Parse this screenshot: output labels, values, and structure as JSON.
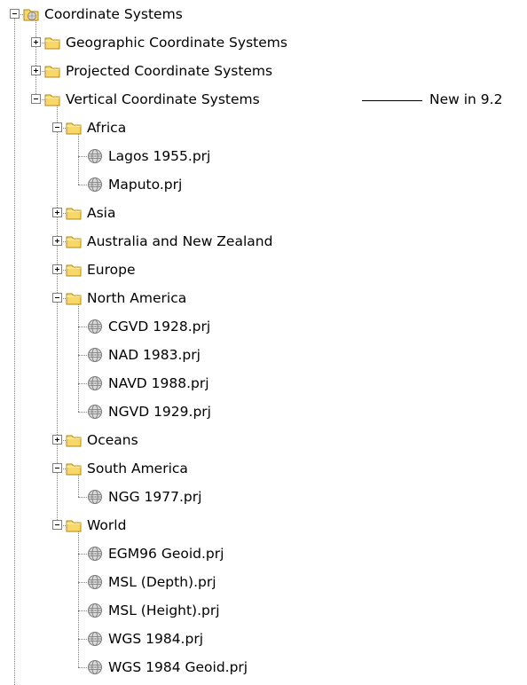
{
  "tree": {
    "root": {
      "label": "Coordinate Systems",
      "expanded": true,
      "icon": "folder-globe-icon"
    },
    "items": [
      {
        "label": "Geographic Coordinate Systems",
        "level": 1,
        "type": "folder",
        "expanded": false
      },
      {
        "label": "Projected Coordinate Systems",
        "level": 1,
        "type": "folder",
        "expanded": false
      },
      {
        "label": "Vertical Coordinate Systems",
        "level": 1,
        "type": "folder",
        "expanded": true
      },
      {
        "label": "Africa",
        "level": 2,
        "type": "folder",
        "expanded": true
      },
      {
        "label": "Lagos 1955.prj",
        "level": 3,
        "type": "file"
      },
      {
        "label": "Maputo.prj",
        "level": 3,
        "type": "file"
      },
      {
        "label": "Asia",
        "level": 2,
        "type": "folder",
        "expanded": false
      },
      {
        "label": "Australia and New Zealand",
        "level": 2,
        "type": "folder",
        "expanded": false
      },
      {
        "label": "Europe",
        "level": 2,
        "type": "folder",
        "expanded": false
      },
      {
        "label": "North America",
        "level": 2,
        "type": "folder",
        "expanded": true
      },
      {
        "label": "CGVD 1928.prj",
        "level": 3,
        "type": "file"
      },
      {
        "label": "NAD 1983.prj",
        "level": 3,
        "type": "file"
      },
      {
        "label": "NAVD 1988.prj",
        "level": 3,
        "type": "file"
      },
      {
        "label": "NGVD 1929.prj",
        "level": 3,
        "type": "file"
      },
      {
        "label": "Oceans",
        "level": 2,
        "type": "folder",
        "expanded": false
      },
      {
        "label": "South America",
        "level": 2,
        "type": "folder",
        "expanded": true
      },
      {
        "label": "NGG 1977.prj",
        "level": 3,
        "type": "file"
      },
      {
        "label": "World",
        "level": 2,
        "type": "folder",
        "expanded": true
      },
      {
        "label": "EGM96 Geoid.prj",
        "level": 3,
        "type": "file"
      },
      {
        "label": "MSL (Depth).prj",
        "level": 3,
        "type": "file"
      },
      {
        "label": "MSL (Height).prj",
        "level": 3,
        "type": "file"
      },
      {
        "label": "WGS 1984.prj",
        "level": 3,
        "type": "file"
      },
      {
        "label": "WGS 1984 Geoid.prj",
        "level": 3,
        "type": "file"
      }
    ]
  },
  "annotation": {
    "text": "New in 9.2"
  },
  "colors": {
    "folder_fill": "#f7d766",
    "folder_edge": "#b08a1a",
    "globe_fill": "#d8d8d8",
    "globe_edge": "#7a7a7a",
    "tree_line": "#808080"
  }
}
